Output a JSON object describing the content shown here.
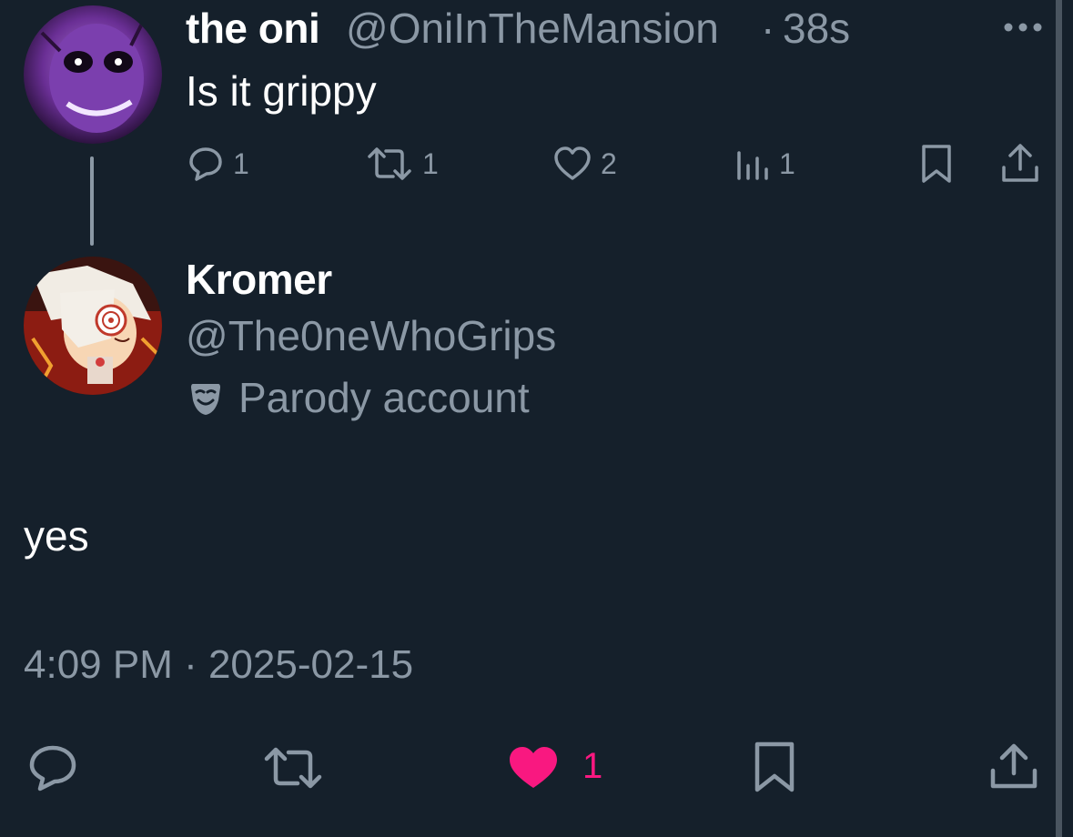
{
  "parent_tweet": {
    "display_name": "the oni",
    "handle": "@OniInTheMansion",
    "separator": "·",
    "time_ago": "38s",
    "text": "Is it grippy",
    "avatar_icon": "purple-character-avatar",
    "actions": {
      "reply_count": "1",
      "retweet_count": "1",
      "like_count": "2",
      "view_count": "1"
    }
  },
  "main_tweet": {
    "display_name": "Kromer",
    "handle": "@The0neWhoGrips",
    "badge_label": "Parody account",
    "badge_icon": "parody-mask-icon",
    "avatar_icon": "anime-character-avatar",
    "text": "yes",
    "timestamp": "4:09 PM · 2025-02-15",
    "like_count": "1"
  },
  "colors": {
    "background": "#15202b",
    "secondary_text": "#8b98a5",
    "like_active": "#f91880"
  }
}
